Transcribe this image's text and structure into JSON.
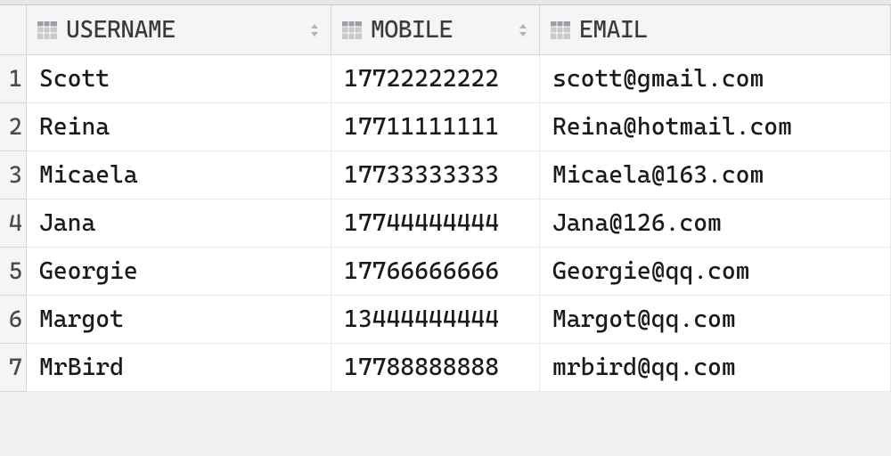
{
  "table": {
    "columns": [
      {
        "label": "USERNAME",
        "sortable": true
      },
      {
        "label": "MOBILE",
        "sortable": true
      },
      {
        "label": "EMAIL",
        "sortable": false
      }
    ],
    "rows": [
      {
        "n": "1",
        "username": "Scott",
        "mobile": "17722222222",
        "email": "scott@gmail.com"
      },
      {
        "n": "2",
        "username": "Reina",
        "mobile": "17711111111",
        "email": "Reina@hotmail.com"
      },
      {
        "n": "3",
        "username": "Micaela",
        "mobile": "17733333333",
        "email": "Micaela@163.com"
      },
      {
        "n": "4",
        "username": "Jana",
        "mobile": "17744444444",
        "email": "Jana@126.com"
      },
      {
        "n": "5",
        "username": "Georgie",
        "mobile": "17766666666",
        "email": "Georgie@qq.com"
      },
      {
        "n": "6",
        "username": "Margot",
        "mobile": "13444444444",
        "email": "Margot@qq.com"
      },
      {
        "n": "7",
        "username": "MrBird",
        "mobile": "17788888888",
        "email": "mrbird@qq.com"
      }
    ]
  },
  "icons": {
    "column": "column-icon",
    "sort": "sort-icon"
  }
}
